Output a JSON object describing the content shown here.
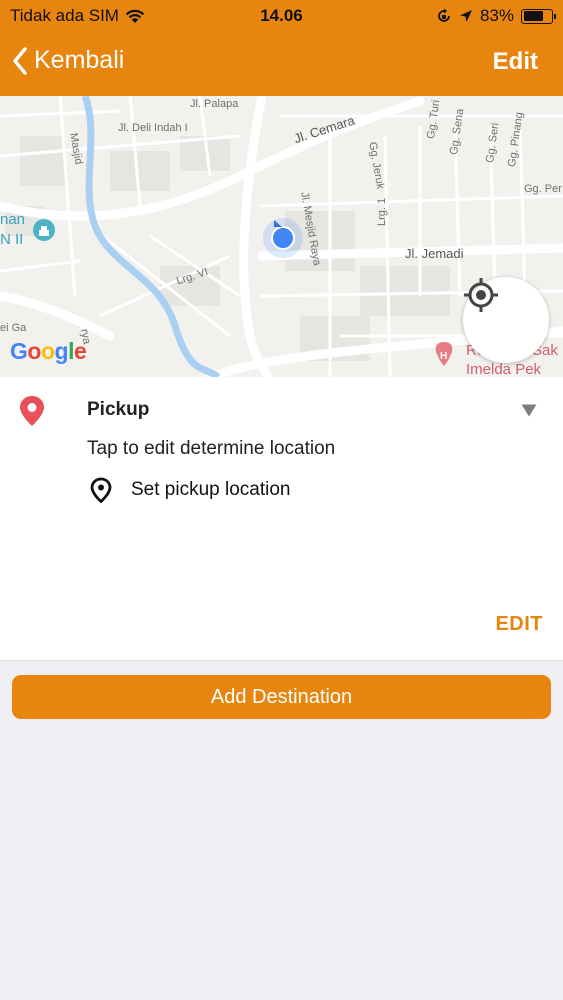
{
  "status_bar": {
    "carrier": "Tidak ada SIM",
    "time": "14.06",
    "battery": "83%",
    "battery_level": 0.83
  },
  "nav": {
    "back_label": "Kembali",
    "edit_label": "Edit"
  },
  "map": {
    "streets": [
      "Jl. Palapa",
      "Jl. Deli Indah I",
      "Jl. Cemara",
      "Jl. Mesjid Raya",
      "Gg. Jeruk",
      "Gg. Turi",
      "Gg. Sena",
      "Gg. Seri",
      "Gg. Pinang",
      "Gg. Per",
      "Lrg. 1",
      "Jl. Jemadi",
      "Lrg. VI",
      "Masjid",
      "rya"
    ],
    "places": [
      "nan",
      "N II",
      "Ru",
      "Sak",
      "Imelda Pek",
      "ei Ga"
    ],
    "logo": "Google"
  },
  "pickup": {
    "title": "Pickup",
    "hint": "Tap to edit determine  location",
    "set_location_label": "Set pickup location",
    "edit_label": "EDIT"
  },
  "add_destination_label": "Add Destination",
  "colors": {
    "accent": "#e8850f",
    "pin": "#e8505b",
    "location_dot": "#4285f4"
  }
}
